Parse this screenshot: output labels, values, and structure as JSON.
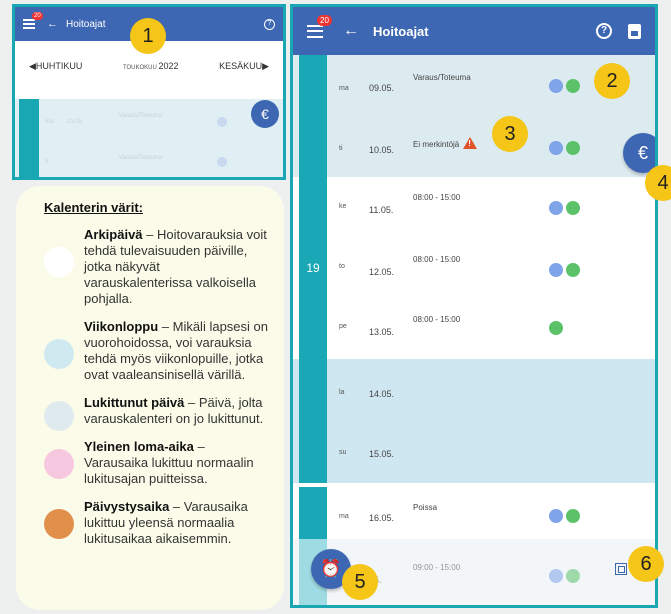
{
  "mini": {
    "badge": "20",
    "title": "Hoitoajat",
    "help": "?",
    "prev_month": "◀HUHTIKUU",
    "current_month": "TOUKOKUU",
    "current_year": "2022",
    "next_month": "KESÄKUU▶",
    "rows": [
      {
        "day": "ma",
        "date": "23.05.",
        "text": "Varaus/Toteuma"
      },
      {
        "day": "ti",
        "date": "",
        "text": "Varaus/Toteuma"
      }
    ],
    "euro": "€"
  },
  "legend": {
    "title": "Kalenterin värit:",
    "items": [
      {
        "name": "Arkipäivä",
        "text": " – Hoitovarauksia voit tehdä tulevaisuuden päiville, jotka näkyvät varauskalenterissa valkoisella pohjalla.",
        "color": "#ffffff"
      },
      {
        "name": "Viikonloppu",
        "text": " – Mikäli lapsesi on vuorohoidossa, voi varauksia tehdä myös viikonlopuille, jotka ovat vaaleansinisellä värillä.",
        "color": "#cfe9f1"
      },
      {
        "name": "Lukittunut päivä",
        "text": " – Päivä, jolta varauskalenteri on jo lukittunut.",
        "color": "#dfeaee"
      },
      {
        "name": "Yleinen loma-aika",
        "text": " – Varausaika lukittuu normaalin lukitusajan puitteissa.",
        "color": "#f7c9e0"
      },
      {
        "name": "Päivystysaika",
        "text": " – Varausaika lukittuu yleensä normaalia lukitusaikaa aikaisemmin.",
        "color": "#e0904a"
      }
    ]
  },
  "big": {
    "badge": "20",
    "title": "Hoitoajat",
    "help": "?",
    "week": "19",
    "rows": [
      {
        "day": "ma",
        "date": "09.05.",
        "desc": "Varaus/Toteuma",
        "dots": [
          "blue",
          "green"
        ]
      },
      {
        "day": "ti",
        "date": "10.05.",
        "desc": "Ei merkintöjä",
        "dots": [
          "blue",
          "green"
        ]
      },
      {
        "day": "ke",
        "date": "11.05.",
        "desc": "08:00 - 15:00",
        "dots": [
          "blue",
          "green"
        ]
      },
      {
        "day": "to",
        "date": "12.05.",
        "desc": "08:00 - 15:00",
        "dots": [
          "blue",
          "green"
        ]
      },
      {
        "day": "pe",
        "date": "13.05.",
        "desc": "08:00 - 15:00",
        "dots": [
          "green"
        ]
      },
      {
        "day": "la",
        "date": "14.05.",
        "desc": "",
        "dots": []
      },
      {
        "day": "su",
        "date": "15.05.",
        "desc": "",
        "dots": []
      },
      {
        "day": "ma",
        "date": "16.05.",
        "desc": "Poissa",
        "dots": [
          "blue",
          "green"
        ]
      },
      {
        "day": "",
        "date": "05.",
        "desc": "09:00 - 15:00",
        "dots": [
          "blue",
          "green"
        ]
      }
    ],
    "euro": "€",
    "alarm": "⏰"
  },
  "markers": [
    "1",
    "2",
    "3",
    "4",
    "5",
    "6"
  ]
}
